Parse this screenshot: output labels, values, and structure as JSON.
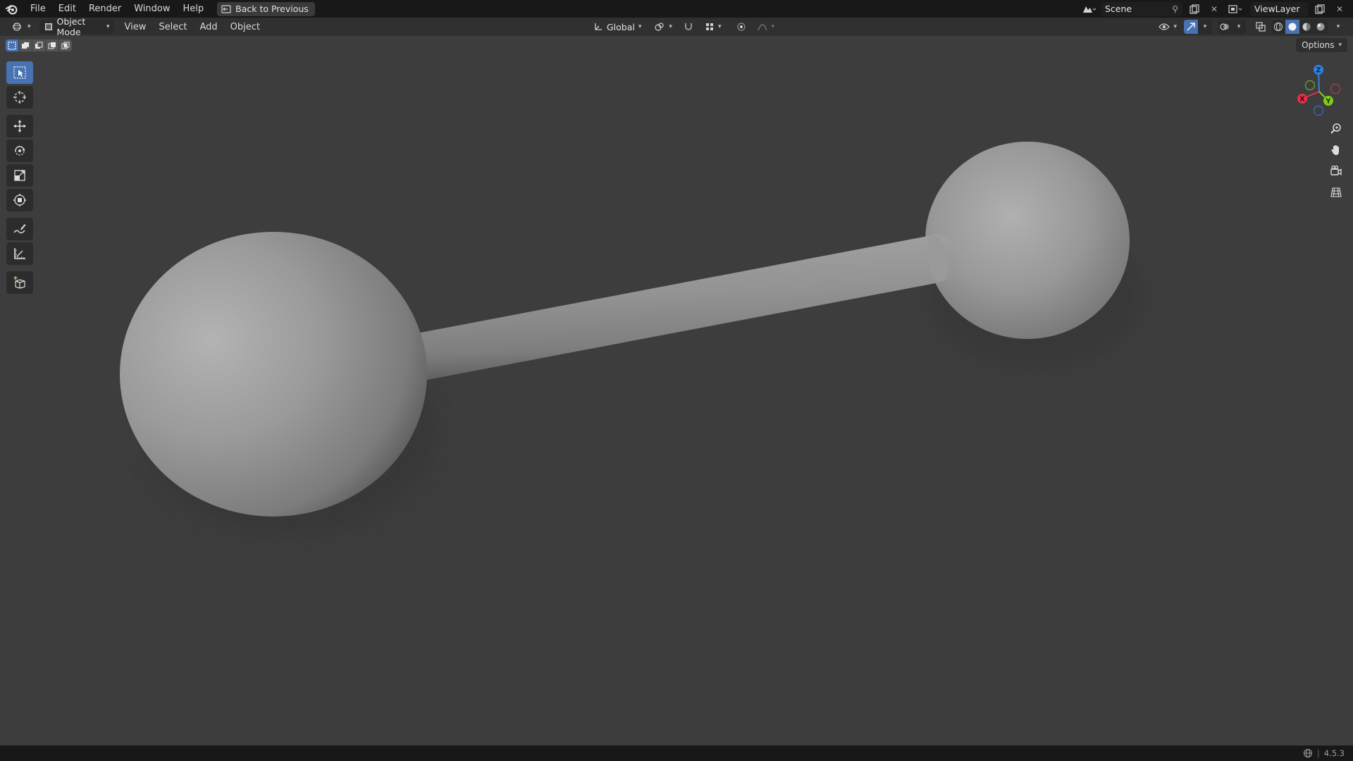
{
  "topbar": {
    "menu": [
      "File",
      "Edit",
      "Render",
      "Window",
      "Help"
    ],
    "back_button": "Back to Previous",
    "scene_name": "Scene",
    "view_layer_name": "ViewLayer"
  },
  "header": {
    "mode": "Object Mode",
    "menu": [
      "View",
      "Select",
      "Add",
      "Object"
    ],
    "transform_orientation": "Global"
  },
  "viewport": {
    "options_label": "Options",
    "gizmo_axes": {
      "x": "X",
      "y": "Y",
      "z": "Z"
    }
  },
  "toolbar": {
    "tools": [
      "select-box",
      "cursor",
      "move",
      "rotate",
      "scale",
      "transform",
      "annotate",
      "measure",
      "add-cube"
    ],
    "active_tool": "select-box"
  },
  "statusbar": {
    "version": "4.5.3"
  },
  "colors": {
    "accent": "#4772b3",
    "axis_x": "#e8304a",
    "axis_y": "#83cc16",
    "axis_z": "#2f83e3",
    "viewport_bg": "#3d3d3d"
  }
}
